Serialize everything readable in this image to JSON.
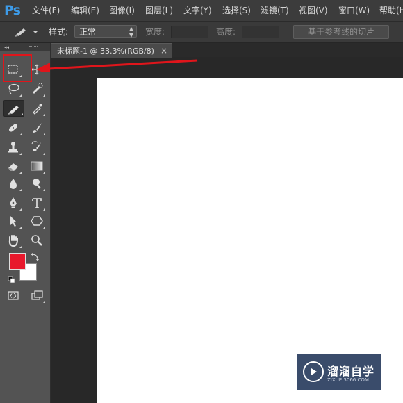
{
  "app": {
    "logo": "Ps",
    "menu": [
      "文件(F)",
      "编辑(E)",
      "图像(I)",
      "图层(L)",
      "文字(Y)",
      "选择(S)",
      "滤镜(T)",
      "视图(V)",
      "窗口(W)",
      "帮助(H)"
    ]
  },
  "options_bar": {
    "style_label": "样式:",
    "style_value": "正常",
    "width_label": "宽度:",
    "height_label": "高度:",
    "slice_button": "基于参考线的切片"
  },
  "document": {
    "tab_title": "未标题-1 @ 33.3%(RGB/8)",
    "close_glyph": "×"
  },
  "toolbox": {
    "collapse_glyph": "◂◂",
    "foreground_color": "#e8182c",
    "background_color": "#ffffff",
    "active_tool": "slice-tool",
    "highlighted_tool": "rectangular-marquee-tool"
  },
  "watermark": {
    "title": "溜溜自学",
    "subtitle": "ZIXUE.3066.COM"
  },
  "colors": {
    "highlight": "#e0151b",
    "logo": "#3d9be9"
  }
}
